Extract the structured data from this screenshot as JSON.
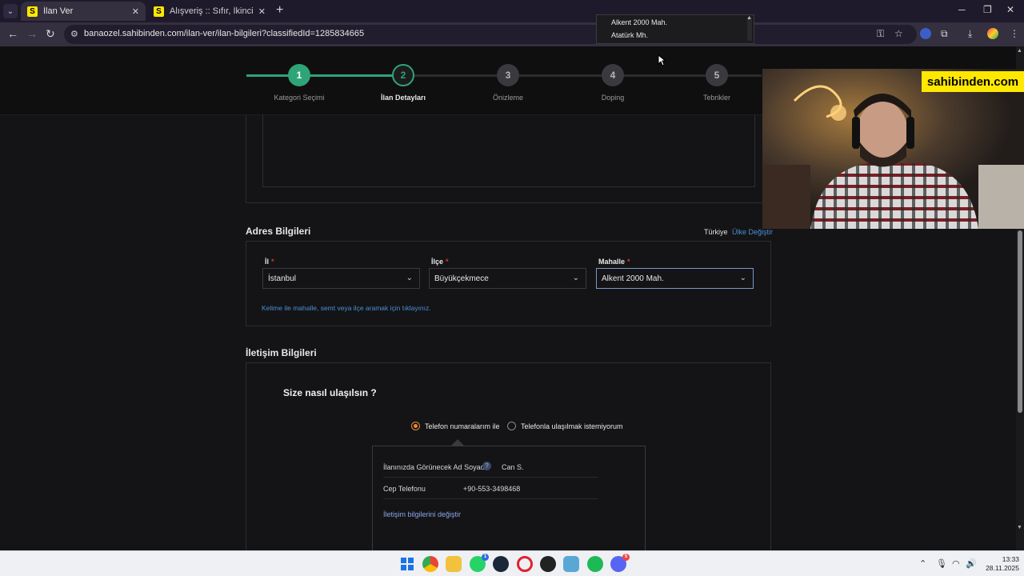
{
  "browser": {
    "tabs": [
      {
        "title": "İlan Ver",
        "favicon": "S",
        "active": true
      },
      {
        "title": "Alışveriş :: Sıfır, İkinci El Ürünler",
        "favicon": "S",
        "active": false
      }
    ],
    "url": "banaozel.sahibinden.com/ilan-ver/ilan-bilgileri?classifiedId=1285834665",
    "icons": [
      "chevron-down-icon",
      "close-icon",
      "plus-icon",
      "minimize-icon",
      "maximize-icon",
      "back-icon",
      "forward-icon",
      "reload-icon",
      "site-info-icon",
      "key-icon",
      "star-icon",
      "extensions-icon",
      "download-icon",
      "profile-icon",
      "menu-icon"
    ]
  },
  "stepper": {
    "steps": [
      {
        "number": "1",
        "label": "Kategori Seçimi",
        "state": "done"
      },
      {
        "number": "2",
        "label": "İlan Detayları",
        "state": "current"
      },
      {
        "number": "3",
        "label": "Önizleme",
        "state": "todo"
      },
      {
        "number": "4",
        "label": "Doping",
        "state": "todo"
      },
      {
        "number": "5",
        "label": "Tebrikler",
        "state": "todo"
      }
    ],
    "accent": "#2fa479"
  },
  "address": {
    "title": "Adres Bilgileri",
    "country": "Türkiye",
    "change_country": "Ülke Değiştir",
    "il_label": "İl",
    "il_value": "İstanbul",
    "ilce_label": "İlçe",
    "ilce_value": "Büyükçekmece",
    "mahalle_label": "Mahalle",
    "mahalle_value": "Alkent 2000 Mah.",
    "required_mark": "*",
    "search_hint": "Kelime ile mahalle, semt veya ilçe aramak için tıklayınız.",
    "dropdown_options": [
      "Alkent 2000 Mah.",
      "Atatürk Mh."
    ]
  },
  "contact": {
    "title": "İletişim Bilgileri",
    "question": "Size nasıl ulaşılsın ?",
    "option_phone": "Telefon numaralarım ile",
    "option_no_phone": "Telefonla ulaşılmak istemiyorum",
    "name_label": "İlanınızda Görünecek Ad Soyad",
    "name_help": "?",
    "name_value": "Can S.",
    "phone_label": "Cep Telefonu",
    "phone_value": "+90-553-3498468",
    "change_link": "İletişim bilgilerini değiştir"
  },
  "overlay": {
    "brand": "sahibinden.com"
  },
  "taskbar": {
    "time": "13:33",
    "date": "28.11.2025",
    "apps": [
      "windows-start-icon",
      "chrome-icon",
      "file-explorer-icon",
      "whatsapp-icon",
      "steam-icon",
      "opera-icon",
      "app-icon",
      "app-icon",
      "spotify-icon",
      "discord-icon"
    ],
    "whatsapp_badge": "1",
    "discord_badge": "5"
  }
}
